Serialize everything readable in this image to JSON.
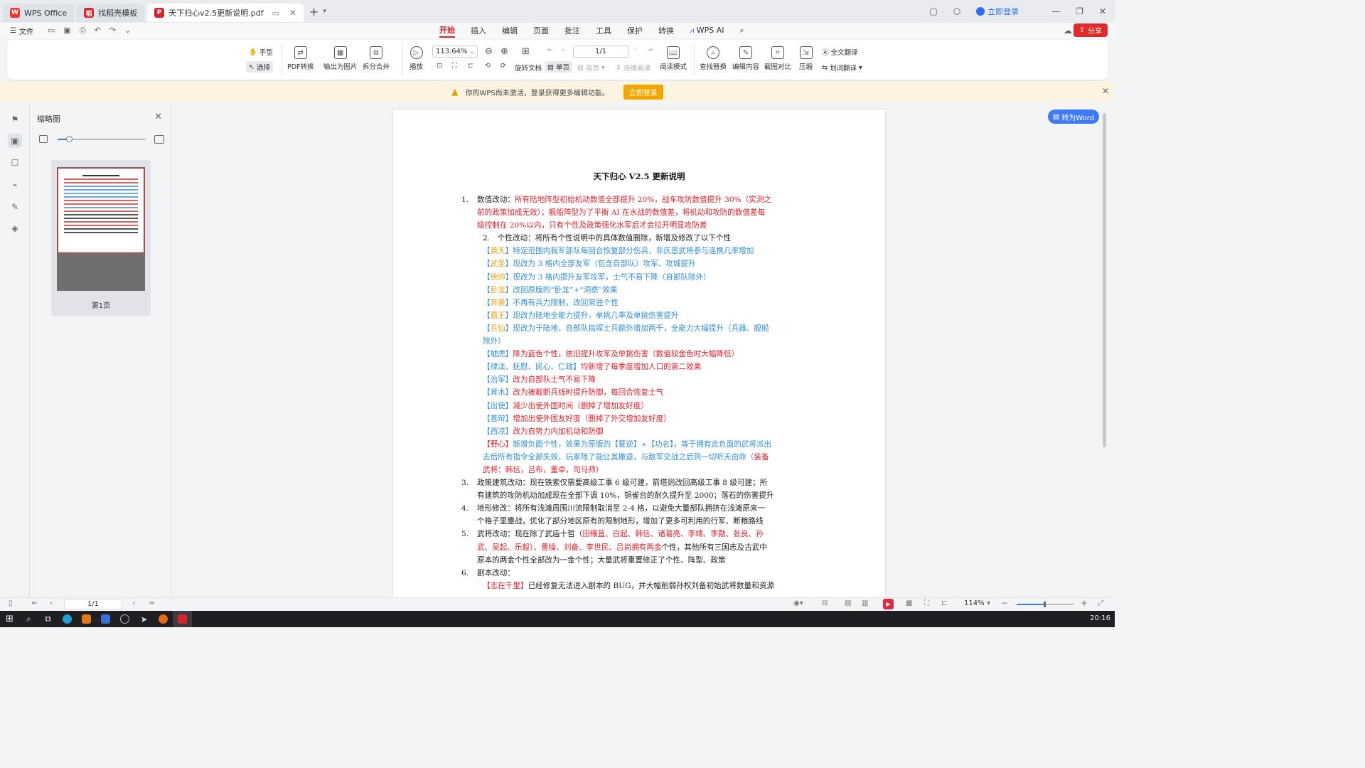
{
  "tabs": {
    "wps": "WPS Office",
    "template": "找稻壳模板",
    "doc": "天下归心v2.5更新说明.pdf",
    "login": "立即登录"
  },
  "menu": {
    "file": "文件",
    "ribbon": [
      "开始",
      "插入",
      "编辑",
      "页面",
      "批注",
      "工具",
      "保护",
      "转换",
      "WPS AI"
    ],
    "share": "分享"
  },
  "toolbar": {
    "hand": "手型",
    "select": "选择",
    "pdf_convert": "PDF转换",
    "export_img": "输出为图片",
    "split_merge": "拆分合并",
    "play": "播放",
    "zoom": "113.64%",
    "page": "1/1",
    "rotate": "旋转文档",
    "single": "单页",
    "double": "双页",
    "continuous": "连续阅读",
    "read_mode": "阅读模式",
    "find_replace": "查找替换",
    "edit_content": "编辑内容",
    "screenshot_compare": "截图对比",
    "compress": "压缩",
    "full_translate": "全文翻译",
    "word_translate": "划词翻译"
  },
  "notice": {
    "text": "你的WPS尚未激活，登录获得更多编辑功能。",
    "button": "立即登录"
  },
  "thumbnail": {
    "title": "缩略图",
    "page_label": "第1页"
  },
  "convert_word": "转为Word",
  "document": {
    "title": "天下归心 V2.5 更新说明",
    "lines": [
      {
        "n": "1.",
        "parts": [
          [
            "",
            "数值改动："
          ],
          [
            "red",
            "所有陆地阵型初始机动数值全部提升 20%，战车攻防数值提升 30%（实测之"
          ]
        ]
      },
      {
        "n": "",
        "parts": [
          [
            "red",
            "前的政策加成无效）；舰船阵型为了平衡 AI 在水战的数值差，将机动和攻防的数值差每"
          ]
        ]
      },
      {
        "n": "",
        "parts": [
          [
            "red",
            "级控制在 20%以内，只有个性及政策强化水军后才会拉开明显攻防差"
          ]
        ]
      },
      {
        "n": "",
        "ind": true,
        "parts": [
          [
            "",
            "2.　个性改动：将所有个性说明中的具体数值删除，新增及修改了以下个性"
          ]
        ]
      },
      {
        "n": "",
        "ind": true,
        "parts": [
          [
            "blue",
            "【"
          ],
          [
            "orange",
            "黄天"
          ],
          [
            "blue",
            "】特定范围内我军部队每回合恢复部分伤兵，非庆恶武将参与连携几率增加"
          ]
        ]
      },
      {
        "n": "",
        "ind": true,
        "parts": [
          [
            "blue",
            "【"
          ],
          [
            "orange",
            "武圣"
          ],
          [
            "blue",
            "】现改为 3 格内全部友军（包含自部队）攻军、攻城提升"
          ]
        ]
      },
      {
        "n": "",
        "ind": true,
        "parts": [
          [
            "blue",
            "【"
          ],
          [
            "orange",
            "统帅"
          ],
          [
            "blue",
            "】现改为 3 格内提升友军攻军，士气不易下降（自部队除外）"
          ]
        ]
      },
      {
        "n": "",
        "ind": true,
        "parts": [
          [
            "blue",
            "【"
          ],
          [
            "orange",
            "卧龙"
          ],
          [
            "blue",
            "】改回原版的“卧龙”+“洞察”效果"
          ]
        ]
      },
      {
        "n": "",
        "ind": true,
        "parts": [
          [
            "blue",
            "【"
          ],
          [
            "orange",
            "奔袭"
          ],
          [
            "blue",
            "】不再有兵力限制，改回常驻个性"
          ]
        ]
      },
      {
        "n": "",
        "ind": true,
        "parts": [
          [
            "blue",
            "【"
          ],
          [
            "orange",
            "霸王"
          ],
          [
            "blue",
            "】现改为陆地全能力提升，单挑几率及单挑伤害提升"
          ]
        ]
      },
      {
        "n": "",
        "ind": true,
        "parts": [
          [
            "blue",
            "【"
          ],
          [
            "orange",
            "兵仙"
          ],
          [
            "blue",
            "】现改为于陆地，自部队指挥士兵额外增加两千，全能力大幅提升（兵器、舰船"
          ]
        ]
      },
      {
        "n": "",
        "ind": true,
        "parts": [
          [
            "blue",
            "除外）"
          ]
        ]
      },
      {
        "n": "",
        "ind": true,
        "parts": [
          [
            "blue",
            "【虓虎】"
          ],
          [
            "red",
            "降为蓝色个性，依旧提升攻军及单挑伤害（数值较金色时大幅降低）"
          ]
        ]
      },
      {
        "n": "",
        "ind": true,
        "parts": [
          [
            "blue",
            "【律法、抚慰、民心、仁政】"
          ],
          [
            "red",
            "均新增了每季度增加人口的第二效果"
          ]
        ]
      },
      {
        "n": "",
        "ind": true,
        "parts": [
          [
            "blue",
            "【治军】"
          ],
          [
            "red",
            "改为自部队士气不易下降"
          ]
        ]
      },
      {
        "n": "",
        "ind": true,
        "parts": [
          [
            "blue",
            "【背水】"
          ],
          [
            "red",
            "改为被截断兵线时提升防御，每回合恢复士气"
          ]
        ]
      },
      {
        "n": "",
        "ind": true,
        "parts": [
          [
            "blue",
            "【出使】"
          ],
          [
            "red",
            "减少出使外国时间（删掉了增加友好度）"
          ]
        ]
      },
      {
        "n": "",
        "ind": true,
        "parts": [
          [
            "blue",
            "【善辩】"
          ],
          [
            "red",
            "增加出使外国友好度（删掉了外交增加友好度）"
          ]
        ]
      },
      {
        "n": "",
        "ind": true,
        "parts": [
          [
            "blue",
            "【西凉】"
          ],
          [
            "red",
            "改为自势力内加机动和防御"
          ]
        ]
      },
      {
        "n": "",
        "ind": true,
        "parts": [
          [
            "red",
            "【野心】"
          ],
          [
            "blue",
            "新增负面个性，效果为原版的【篡逆】+【功名】，等于拥有此负面的武将派出"
          ]
        ]
      },
      {
        "n": "",
        "ind": true,
        "parts": [
          [
            "blue",
            "去后所有指令全部失效，玩家除了能让其撤退，与敌军交战之后则一切听天由命（"
          ],
          [
            "red",
            "装备"
          ]
        ]
      },
      {
        "n": "",
        "ind": true,
        "parts": [
          [
            "red",
            "武将：韩信，吕布，董卓，司马师）"
          ]
        ]
      },
      {
        "n": "3.",
        "parts": [
          [
            "",
            "政策建筑改动：现在铁索仅需要高级工事 6 级可建，箭塔则改回高级工事 8 级可建；所"
          ]
        ]
      },
      {
        "n": "",
        "parts": [
          [
            "",
            "有建筑的攻防机动加成现在全部下调 10%，铜雀台的耐久提升至 2000；落石的伤害提升"
          ]
        ]
      },
      {
        "n": "4.",
        "parts": [
          [
            "",
            "地形修改：将所有浅滩周围川流限制取消至 2-4 格，以避免大量部队拥挤在浅滩原来一"
          ]
        ]
      },
      {
        "n": "",
        "parts": [
          [
            "",
            "个格子里鏖战，优化了部分地区原有的限制地形，增加了更多可利用的行军、断粮路线"
          ]
        ]
      },
      {
        "n": "5.",
        "parts": [
          [
            "",
            "武将改动：现在除了武庙十哲（"
          ],
          [
            "red",
            "田穰苴、白起、韩信、诸葛亮、李靖、李勣、张良、孙"
          ]
        ]
      },
      {
        "n": "",
        "parts": [
          [
            "red",
            "武、吴起、乐毅）、曹操、刘备、李世民、吕尚拥有两金"
          ],
          [
            "",
            "个性，其他所有三国志及古武中"
          ]
        ]
      },
      {
        "n": "",
        "parts": [
          [
            "",
            "原本的两金个性全部改为一金个性；大量武将重置修正了个性、阵型、政策"
          ]
        ]
      },
      {
        "n": "6.",
        "parts": [
          [
            "",
            "剧本改动："
          ]
        ]
      },
      {
        "n": "",
        "ind": true,
        "parts": [
          [
            "red",
            "【志在千里】"
          ],
          [
            "",
            "已经修复无法进入剧本的 BUG，并大幅削弱孙权刘备初始武将数量和资源"
          ]
        ]
      }
    ]
  },
  "status": {
    "page": "1/1",
    "zoom": "114%"
  },
  "clock": "20:16"
}
